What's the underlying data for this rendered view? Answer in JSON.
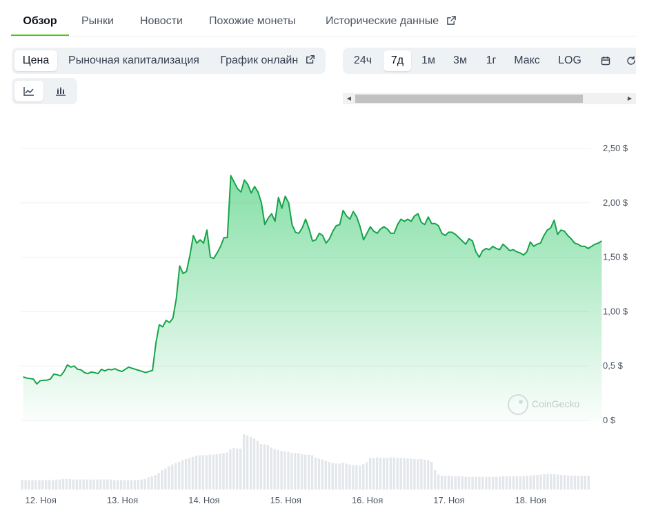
{
  "tabs": [
    {
      "label": "Обзор",
      "active": true
    },
    {
      "label": "Рынки"
    },
    {
      "label": "Новости"
    },
    {
      "label": "Похожие монеты"
    },
    {
      "label": "Исторические данные",
      "external": true
    }
  ],
  "metric_tabs": [
    {
      "label": "Цена",
      "active": true
    },
    {
      "label": "Рыночная капитализация"
    },
    {
      "label": "График онлайн",
      "external": true
    }
  ],
  "chart_types": [
    {
      "icon": "line-chart-icon",
      "active": true
    },
    {
      "icon": "candlestick-chart-icon"
    }
  ],
  "range_tabs": [
    {
      "label": "24ч"
    },
    {
      "label": "7д",
      "active": true
    },
    {
      "label": "1м"
    },
    {
      "label": "3м"
    },
    {
      "label": "1г"
    },
    {
      "label": "Макс"
    },
    {
      "label": "LOG"
    },
    {
      "icon": "calendar-icon"
    },
    {
      "icon": "refresh-icon"
    }
  ],
  "watermark": "CoinGecko",
  "colors": {
    "line": "#16a34a",
    "accent": "#4bcc00",
    "volume": "#e3e6ea",
    "grid": "#eef0f3"
  },
  "chart_data": {
    "type": "area",
    "title": "",
    "xlabel": "",
    "ylabel": "",
    "x_ticks": [
      "12. Ноя",
      "13. Ноя",
      "14. Ноя",
      "15. Ноя",
      "16. Ноя",
      "17. Ноя",
      "18. Ноя"
    ],
    "y_ticks": [
      {
        "value": 0,
        "label": "0 $"
      },
      {
        "value": 0.5,
        "label": "0,5 $"
      },
      {
        "value": 1.0,
        "label": "1,00 $"
      },
      {
        "value": 1.5,
        "label": "1,50 $"
      },
      {
        "value": 2.0,
        "label": "2,00 $"
      },
      {
        "value": 2.5,
        "label": "2,50 $"
      }
    ],
    "ylim": [
      0,
      2.5
    ],
    "x_range_days": [
      -0.03,
      6.95
    ],
    "grid": true,
    "price_series": {
      "name": "",
      "x_days_step": 0.0417,
      "values": [
        0.4,
        0.39,
        0.385,
        0.38,
        0.335,
        0.365,
        0.37,
        0.37,
        0.38,
        0.425,
        0.42,
        0.41,
        0.45,
        0.51,
        0.49,
        0.5,
        0.47,
        0.465,
        0.44,
        0.43,
        0.445,
        0.44,
        0.43,
        0.47,
        0.455,
        0.47,
        0.465,
        0.475,
        0.46,
        0.45,
        0.47,
        0.49,
        0.48,
        0.47,
        0.46,
        0.45,
        0.44,
        0.45,
        0.46,
        0.71,
        0.88,
        0.86,
        0.92,
        0.9,
        0.94,
        1.12,
        1.42,
        1.35,
        1.37,
        1.52,
        1.7,
        1.63,
        1.66,
        1.63,
        1.75,
        1.5,
        1.49,
        1.54,
        1.6,
        1.68,
        1.68,
        2.25,
        2.19,
        2.13,
        2.1,
        2.21,
        2.17,
        2.09,
        2.15,
        2.1,
        2.0,
        1.8,
        1.86,
        1.9,
        1.83,
        2.05,
        1.95,
        2.06,
        2.0,
        1.8,
        1.73,
        1.72,
        1.77,
        1.85,
        1.76,
        1.65,
        1.66,
        1.72,
        1.7,
        1.63,
        1.67,
        1.74,
        1.79,
        1.8,
        1.93,
        1.88,
        1.85,
        1.92,
        1.87,
        1.78,
        1.66,
        1.72,
        1.78,
        1.74,
        1.72,
        1.76,
        1.78,
        1.76,
        1.72,
        1.72,
        1.8,
        1.85,
        1.83,
        1.85,
        1.83,
        1.88,
        1.9,
        1.82,
        1.8,
        1.87,
        1.81,
        1.81,
        1.79,
        1.72,
        1.7,
        1.73,
        1.73,
        1.71,
        1.68,
        1.65,
        1.62,
        1.67,
        1.65,
        1.55,
        1.5,
        1.56,
        1.58,
        1.57,
        1.6,
        1.58,
        1.57,
        1.62,
        1.59,
        1.56,
        1.57,
        1.55,
        1.54,
        1.52,
        1.55,
        1.64,
        1.6,
        1.62,
        1.63,
        1.7,
        1.75,
        1.77,
        1.84,
        1.71,
        1.75,
        1.74,
        1.7,
        1.67,
        1.63,
        1.62,
        1.6,
        1.6,
        1.58,
        1.6,
        1.62,
        1.63,
        1.65
      ]
    },
    "volume_series": {
      "name": "",
      "values": [
        0.17,
        0.17,
        0.17,
        0.17,
        0.17,
        0.17,
        0.17,
        0.17,
        0.17,
        0.17,
        0.18,
        0.18,
        0.19,
        0.19,
        0.19,
        0.18,
        0.18,
        0.18,
        0.18,
        0.18,
        0.18,
        0.18,
        0.18,
        0.18,
        0.18,
        0.18,
        0.18,
        0.17,
        0.17,
        0.17,
        0.17,
        0.17,
        0.17,
        0.17,
        0.17,
        0.18,
        0.19,
        0.22,
        0.24,
        0.26,
        0.3,
        0.35,
        0.38,
        0.42,
        0.45,
        0.48,
        0.5,
        0.53,
        0.55,
        0.57,
        0.59,
        0.61,
        0.62,
        0.62,
        0.62,
        0.63,
        0.63,
        0.64,
        0.65,
        0.66,
        0.67,
        0.73,
        0.75,
        0.74,
        0.74,
        1.0,
        0.98,
        0.95,
        0.92,
        0.88,
        0.82,
        0.82,
        0.8,
        0.76,
        0.73,
        0.71,
        0.7,
        0.69,
        0.68,
        0.66,
        0.66,
        0.66,
        0.64,
        0.63,
        0.63,
        0.62,
        0.58,
        0.56,
        0.54,
        0.52,
        0.5,
        0.48,
        0.47,
        0.47,
        0.48,
        0.47,
        0.45,
        0.44,
        0.44,
        0.43,
        0.46,
        0.49,
        0.57,
        0.57,
        0.58,
        0.57,
        0.57,
        0.57,
        0.58,
        0.58,
        0.57,
        0.57,
        0.57,
        0.56,
        0.56,
        0.55,
        0.55,
        0.55,
        0.54,
        0.53,
        0.5,
        0.35,
        0.27,
        0.25,
        0.25,
        0.25,
        0.24,
        0.24,
        0.24,
        0.24,
        0.23,
        0.23,
        0.23,
        0.23,
        0.23,
        0.23,
        0.23,
        0.23,
        0.23,
        0.23,
        0.23,
        0.24,
        0.24,
        0.24,
        0.24,
        0.24,
        0.24,
        0.24,
        0.25,
        0.25,
        0.26,
        0.26,
        0.27,
        0.28,
        0.28,
        0.28,
        0.28,
        0.27,
        0.26,
        0.26,
        0.25,
        0.25,
        0.25,
        0.25,
        0.25,
        0.25,
        0.25
      ]
    }
  }
}
